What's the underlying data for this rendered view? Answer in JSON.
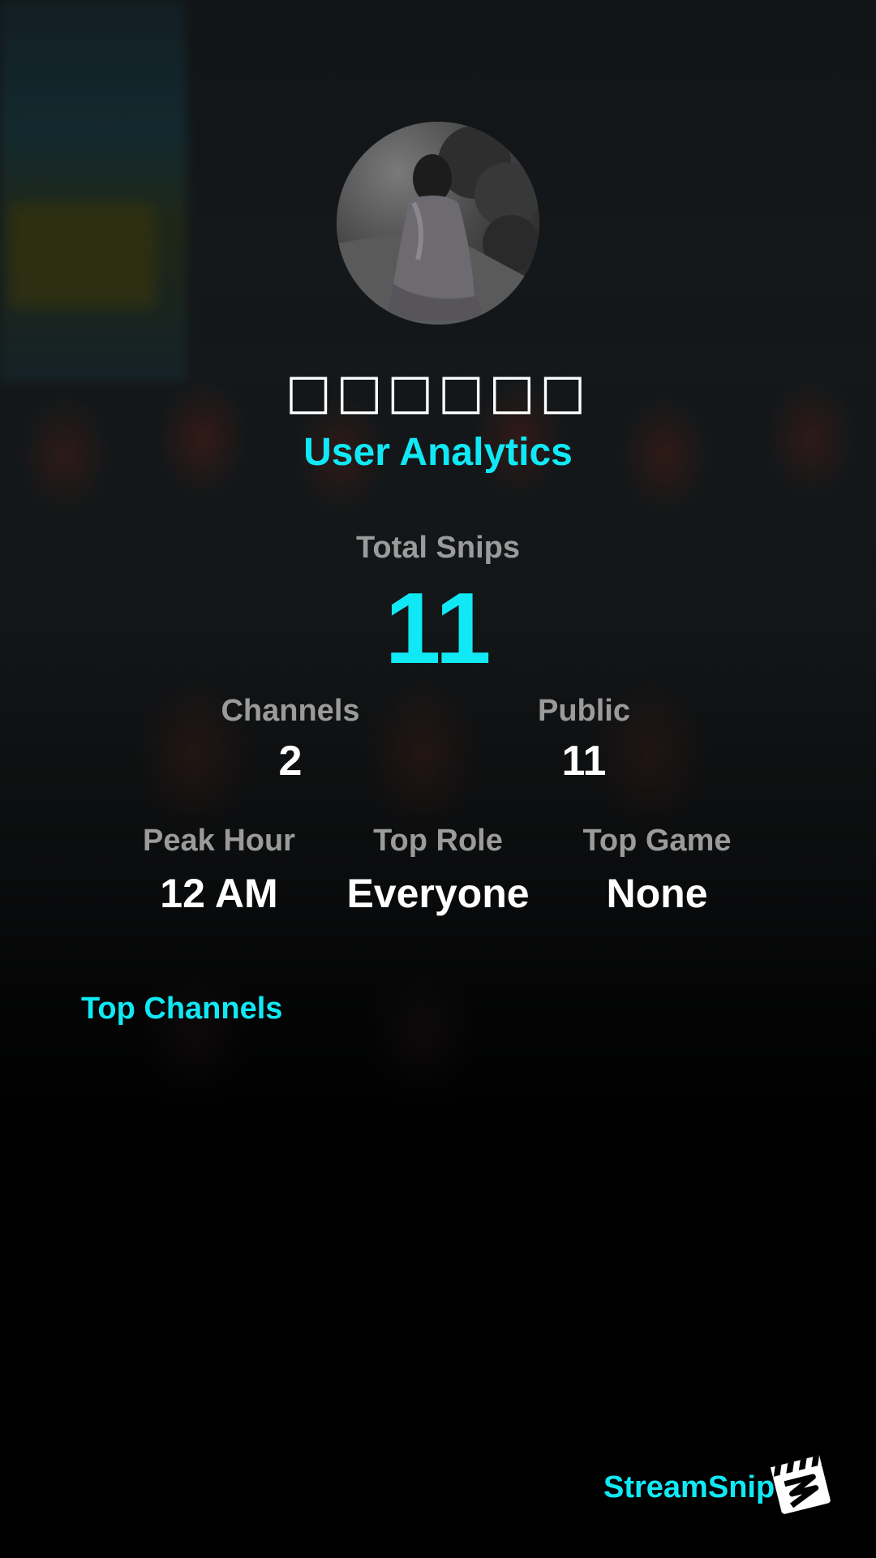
{
  "profile": {
    "username": "□□□□□□",
    "avatar_alt": "avatar"
  },
  "header": {
    "subtitle": "User Analytics"
  },
  "stats": {
    "total_snips_label": "Total Snips",
    "total_snips_value": "11",
    "channels_label": "Channels",
    "channels_value": "2",
    "public_label": "Public",
    "public_value": "11",
    "peak_hour_label": "Peak Hour",
    "peak_hour_value": "12 AM",
    "top_role_label": "Top Role",
    "top_role_value": "Everyone",
    "top_game_label": "Top Game",
    "top_game_value": "None"
  },
  "sections": {
    "top_channels_label": "Top Channels"
  },
  "branding": {
    "name": "StreamSnip",
    "logo_icon": "clapperboard-icon"
  },
  "colors": {
    "accent": "#10e9f5",
    "label_gray": "#9b9b9b",
    "value_white": "#ffffff",
    "background": "#000000"
  }
}
